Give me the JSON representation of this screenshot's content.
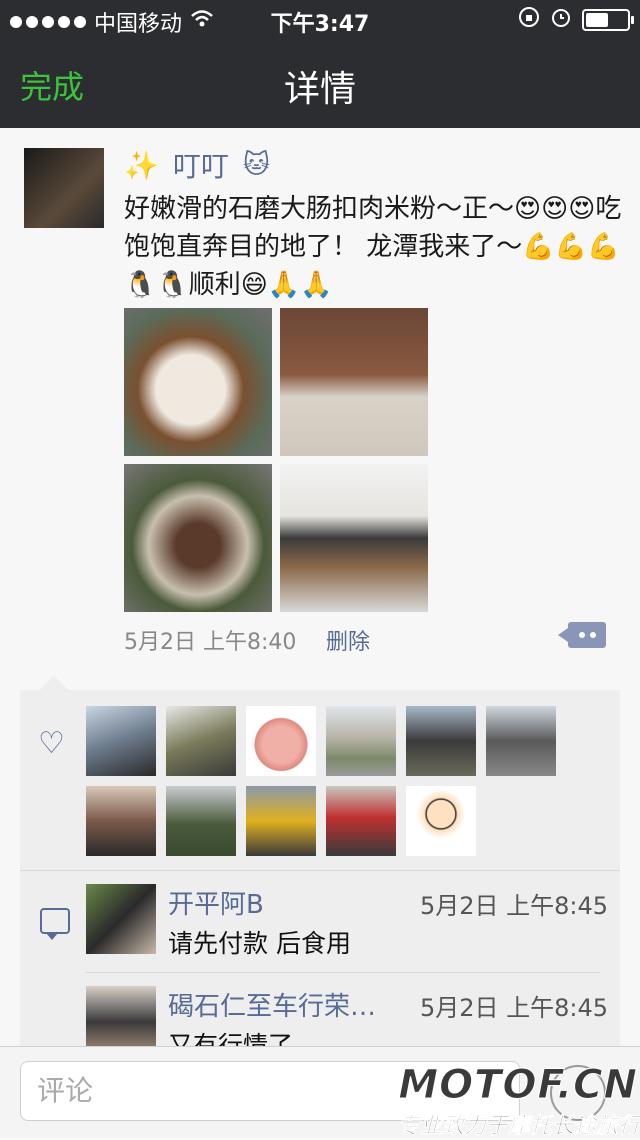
{
  "status_bar": {
    "carrier": "中国移动",
    "time": "下午3:47"
  },
  "nav": {
    "done_label": "完成",
    "title": "详情"
  },
  "post": {
    "username": "叮叮",
    "text": "好嫩滑的石磨大肠扣肉米粉～正～😍😍😍吃饱饱直奔目的地了！ 龙潭我来了～💪💪💪🐧🐧顺利😄🙏🙏",
    "time": "5月2日 上午8:40",
    "delete_label": "删除"
  },
  "comments": [
    {
      "name": "开平阿B",
      "time": "5月2日 上午8:45",
      "text": "请先付款 后食用"
    },
    {
      "name": "碣石仁至车行荣…",
      "time": "5月2日 上午8:45",
      "text": "又有行情了。"
    }
  ],
  "input": {
    "placeholder": "评论"
  },
  "watermark": {
    "logo": "MOTOF.CN",
    "slogan": "专业致力于摩托长途旅行"
  },
  "colors": {
    "nav_bg": "#2c2d31",
    "accent_green": "#3cc23c",
    "link_blue": "#576b95"
  }
}
